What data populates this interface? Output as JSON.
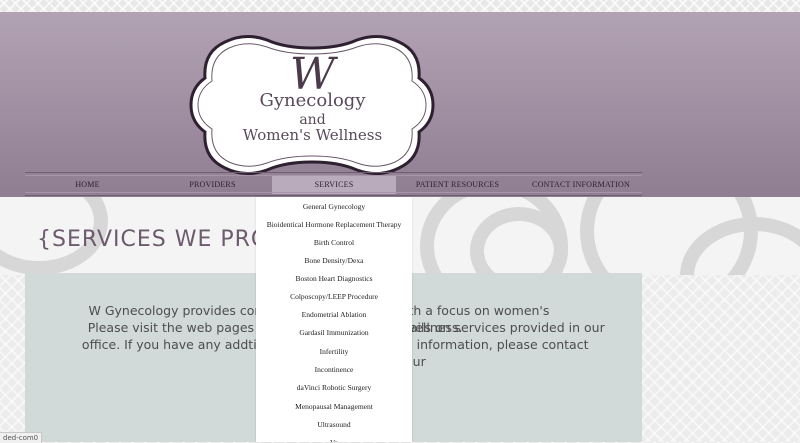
{
  "logo": {
    "monogram": "W",
    "line1": "Gynecology",
    "line2": "and",
    "line3": "Women's Wellness"
  },
  "nav": {
    "items": [
      {
        "label": "HOME"
      },
      {
        "label": "PROVIDERS"
      },
      {
        "label": "SERVICES"
      },
      {
        "label": "PATIENT RESOURCES"
      },
      {
        "label": "CONTACT INFORMATION"
      }
    ]
  },
  "page": {
    "title": "{SERVICES WE PROV",
    "paragraph_lines": [
      "W Gynecology provides compreh",
      "ith a focus on women's wellness.",
      "Please visit the web pages below",
      "tails on services provided in our",
      "office.  If you have any addtional o",
      "e information, please contact our"
    ]
  },
  "dropdown": {
    "items": [
      "General Gynecology",
      "Bioidentical Hormone Replacement Therapy",
      "Birth Control",
      "Bone Density/Dexa",
      "Boston Heart Diagnostics",
      "Colposcopy/LEEP Procedure",
      "Endometrial Ablation",
      "Gardasil Immunization",
      "Infertility",
      "Incontinence",
      "daVinci Robotic Surgery",
      "Menopausal Management",
      "Ultrasound",
      "Ve"
    ]
  },
  "status": {
    "text": "ded-com0"
  },
  "colors": {
    "header_top": "#b2a3b4",
    "header_bottom": "#8f7d91",
    "title": "#6c5a6d",
    "content_bg": "#d1d9d9",
    "nav_active": "#b9abbb"
  }
}
